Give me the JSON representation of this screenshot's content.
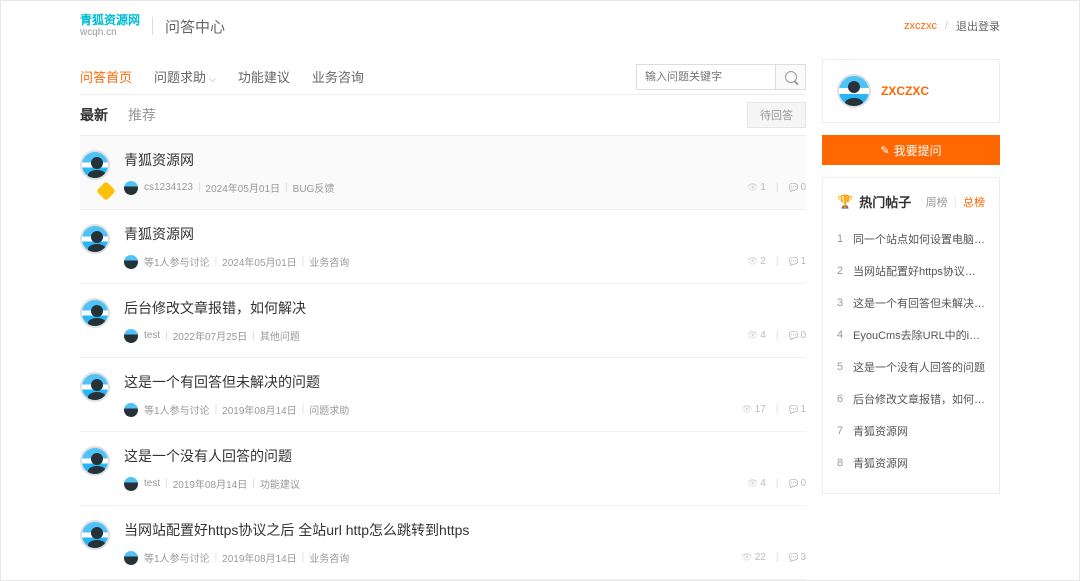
{
  "header": {
    "logo_top": "青狐资源网",
    "logo_bottom": "wcqh.cn",
    "title": "问答中心",
    "username": "zxczxc",
    "sep": "/",
    "logout": "退出登录"
  },
  "nav": {
    "items": [
      "问答首页",
      "问题求助",
      "功能建议",
      "业务咨询"
    ],
    "active": 0,
    "search_placeholder": "输入问题关键字"
  },
  "tabs": {
    "latest": "最新",
    "recommend": "推荐",
    "pending": "待回答"
  },
  "posts": [
    {
      "title": "青狐资源网",
      "author": "cs1234123",
      "date": "2024年05月01日",
      "cat": "BUG反馈",
      "views": "1",
      "comments": "0",
      "pinned": true,
      "prefix": ""
    },
    {
      "title": "青狐资源网",
      "author": "等1人参与讨论",
      "date": "2024年05月01日",
      "cat": "业务咨询",
      "views": "2",
      "comments": "1",
      "pinned": false,
      "prefix": ""
    },
    {
      "title": "后台修改文章报错，如何解决",
      "author": "test",
      "date": "2022年07月25日",
      "cat": "其他问题",
      "views": "4",
      "comments": "0",
      "pinned": false,
      "prefix": ""
    },
    {
      "title": "这是一个有回答但未解决的问题",
      "author": "等1人参与讨论",
      "date": "2019年08月14日",
      "cat": "问题求助",
      "views": "17",
      "comments": "1",
      "pinned": false,
      "prefix": ""
    },
    {
      "title": "这是一个没有人回答的问题",
      "author": "test",
      "date": "2019年08月14日",
      "cat": "功能建议",
      "views": "4",
      "comments": "0",
      "pinned": false,
      "prefix": ""
    },
    {
      "title": "当网站配置好https协议之后 全站url http怎么跳转到https",
      "author": "等1人参与讨论",
      "date": "2019年08月14日",
      "cat": "业务咨询",
      "views": "22",
      "comments": "3",
      "pinned": false,
      "prefix": ""
    }
  ],
  "sidebar": {
    "username": "ZXCZXC",
    "ask_label": "我要提问",
    "hot_title": "热门帖子",
    "week": "周榜",
    "total": "总榜",
    "hot_list": [
      "同一个站点如何设置电脑端是www.XX...",
      "当网站配置好https协议之后 全站url h...",
      "这是一个有回答但未解决的问题",
      "EyouCms去除URL中的index.php",
      "这是一个没有人回答的问题",
      "后台修改文章报错，如何解决",
      "青狐资源网",
      "青狐资源网"
    ]
  }
}
